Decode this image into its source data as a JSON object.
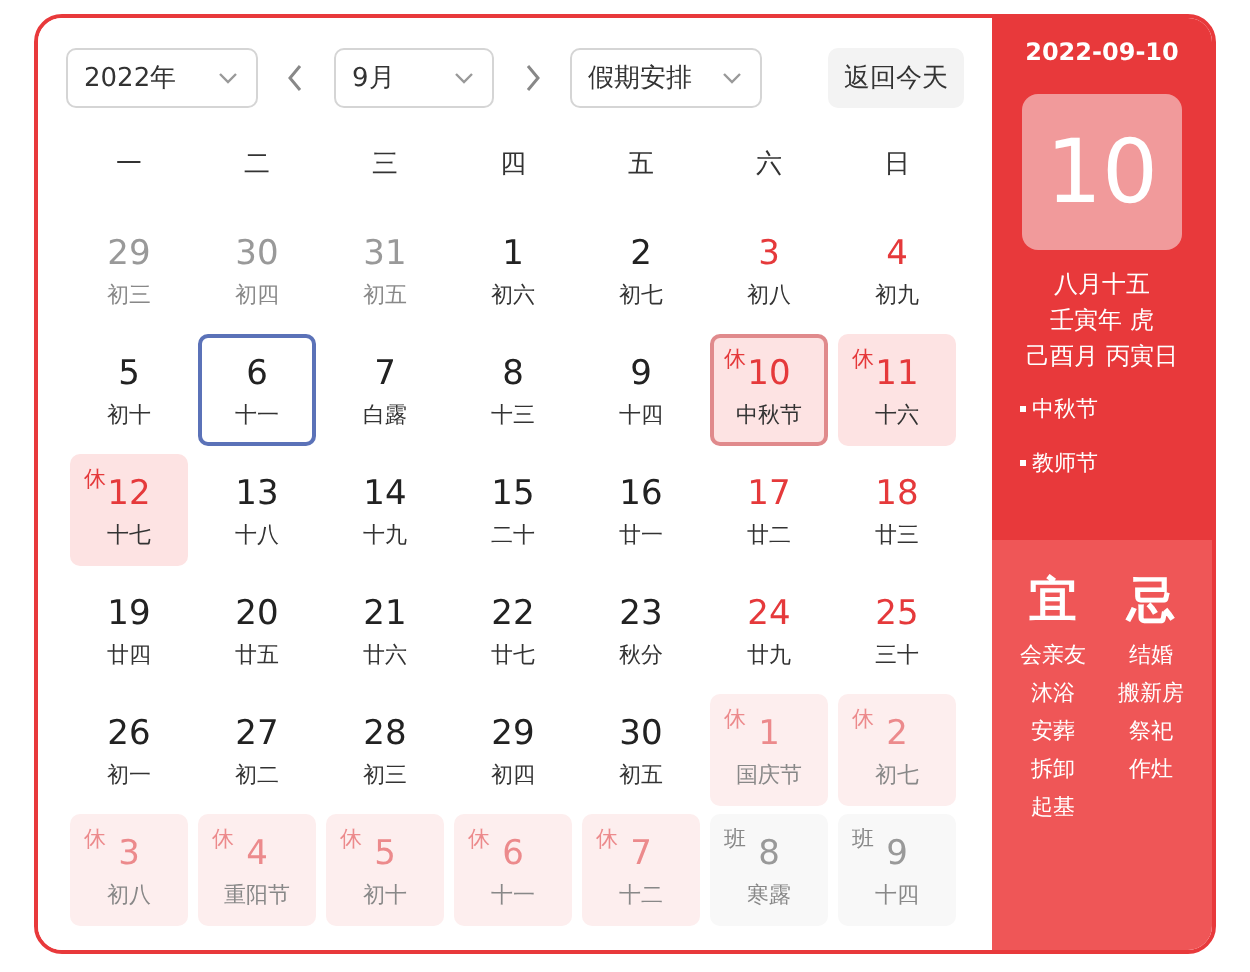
{
  "toolbar": {
    "year": "2022年",
    "month": "9月",
    "holiday": "假期安排",
    "today_button": "返回今天"
  },
  "weekdays": [
    "一",
    "二",
    "三",
    "四",
    "五",
    "六",
    "日"
  ],
  "days": [
    {
      "day": "29",
      "lunar": "初三",
      "muted": true,
      "red": false,
      "kind": "normal",
      "selected": false,
      "today": false
    },
    {
      "day": "30",
      "lunar": "初四",
      "muted": true,
      "red": false,
      "kind": "normal",
      "selected": false,
      "today": false
    },
    {
      "day": "31",
      "lunar": "初五",
      "muted": true,
      "red": false,
      "kind": "normal",
      "selected": false,
      "today": false
    },
    {
      "day": "1",
      "lunar": "初六",
      "muted": false,
      "red": false,
      "kind": "normal",
      "selected": false,
      "today": false
    },
    {
      "day": "2",
      "lunar": "初七",
      "muted": false,
      "red": false,
      "kind": "normal",
      "selected": false,
      "today": false
    },
    {
      "day": "3",
      "lunar": "初八",
      "muted": false,
      "red": true,
      "kind": "normal",
      "selected": false,
      "today": false
    },
    {
      "day": "4",
      "lunar": "初九",
      "muted": false,
      "red": true,
      "kind": "normal",
      "selected": false,
      "today": false
    },
    {
      "day": "5",
      "lunar": "初十",
      "muted": false,
      "red": false,
      "kind": "normal",
      "selected": false,
      "today": false
    },
    {
      "day": "6",
      "lunar": "十一",
      "muted": false,
      "red": false,
      "kind": "normal",
      "selected": false,
      "today": true
    },
    {
      "day": "7",
      "lunar": "白露",
      "muted": false,
      "red": false,
      "kind": "normal",
      "selected": false,
      "today": false
    },
    {
      "day": "8",
      "lunar": "十三",
      "muted": false,
      "red": false,
      "kind": "normal",
      "selected": false,
      "today": false
    },
    {
      "day": "9",
      "lunar": "十四",
      "muted": false,
      "red": false,
      "kind": "normal",
      "selected": false,
      "today": false
    },
    {
      "day": "10",
      "lunar": "中秋节",
      "badge": "休",
      "muted": false,
      "red": true,
      "kind": "rest",
      "selected": true,
      "today": false
    },
    {
      "day": "11",
      "lunar": "十六",
      "badge": "休",
      "muted": false,
      "red": true,
      "kind": "rest",
      "selected": false,
      "today": false
    },
    {
      "day": "12",
      "lunar": "十七",
      "badge": "休",
      "muted": false,
      "red": true,
      "kind": "rest",
      "selected": false,
      "today": false
    },
    {
      "day": "13",
      "lunar": "十八",
      "muted": false,
      "red": false,
      "kind": "normal",
      "selected": false,
      "today": false
    },
    {
      "day": "14",
      "lunar": "十九",
      "muted": false,
      "red": false,
      "kind": "normal",
      "selected": false,
      "today": false
    },
    {
      "day": "15",
      "lunar": "二十",
      "muted": false,
      "red": false,
      "kind": "normal",
      "selected": false,
      "today": false
    },
    {
      "day": "16",
      "lunar": "廿一",
      "muted": false,
      "red": false,
      "kind": "normal",
      "selected": false,
      "today": false
    },
    {
      "day": "17",
      "lunar": "廿二",
      "muted": false,
      "red": true,
      "kind": "normal",
      "selected": false,
      "today": false
    },
    {
      "day": "18",
      "lunar": "廿三",
      "muted": false,
      "red": true,
      "kind": "normal",
      "selected": false,
      "today": false
    },
    {
      "day": "19",
      "lunar": "廿四",
      "muted": false,
      "red": false,
      "kind": "normal",
      "selected": false,
      "today": false
    },
    {
      "day": "20",
      "lunar": "廿五",
      "muted": false,
      "red": false,
      "kind": "normal",
      "selected": false,
      "today": false
    },
    {
      "day": "21",
      "lunar": "廿六",
      "muted": false,
      "red": false,
      "kind": "normal",
      "selected": false,
      "today": false
    },
    {
      "day": "22",
      "lunar": "廿七",
      "muted": false,
      "red": false,
      "kind": "normal",
      "selected": false,
      "today": false
    },
    {
      "day": "23",
      "lunar": "秋分",
      "muted": false,
      "red": false,
      "kind": "normal",
      "selected": false,
      "today": false
    },
    {
      "day": "24",
      "lunar": "廿九",
      "muted": false,
      "red": true,
      "kind": "normal",
      "selected": false,
      "today": false
    },
    {
      "day": "25",
      "lunar": "三十",
      "muted": false,
      "red": true,
      "kind": "normal",
      "selected": false,
      "today": false
    },
    {
      "day": "26",
      "lunar": "初一",
      "muted": false,
      "red": false,
      "kind": "normal",
      "selected": false,
      "today": false
    },
    {
      "day": "27",
      "lunar": "初二",
      "muted": false,
      "red": false,
      "kind": "normal",
      "selected": false,
      "today": false
    },
    {
      "day": "28",
      "lunar": "初三",
      "muted": false,
      "red": false,
      "kind": "normal",
      "selected": false,
      "today": false
    },
    {
      "day": "29",
      "lunar": "初四",
      "muted": false,
      "red": false,
      "kind": "normal",
      "selected": false,
      "today": false
    },
    {
      "day": "30",
      "lunar": "初五",
      "muted": false,
      "red": false,
      "kind": "normal",
      "selected": false,
      "today": false
    },
    {
      "day": "1",
      "lunar": "国庆节",
      "badge": "休",
      "muted": true,
      "red": true,
      "kind": "rest",
      "selected": false,
      "today": false
    },
    {
      "day": "2",
      "lunar": "初七",
      "badge": "休",
      "muted": true,
      "red": true,
      "kind": "rest",
      "selected": false,
      "today": false
    },
    {
      "day": "3",
      "lunar": "初八",
      "badge": "休",
      "muted": true,
      "red": true,
      "kind": "rest",
      "selected": false,
      "today": false
    },
    {
      "day": "4",
      "lunar": "重阳节",
      "badge": "休",
      "muted": true,
      "red": true,
      "kind": "rest",
      "selected": false,
      "today": false
    },
    {
      "day": "5",
      "lunar": "初十",
      "badge": "休",
      "muted": true,
      "red": true,
      "kind": "rest",
      "selected": false,
      "today": false
    },
    {
      "day": "6",
      "lunar": "十一",
      "badge": "休",
      "muted": true,
      "red": true,
      "kind": "rest",
      "selected": false,
      "today": false
    },
    {
      "day": "7",
      "lunar": "十二",
      "badge": "休",
      "muted": true,
      "red": true,
      "kind": "rest",
      "selected": false,
      "today": false
    },
    {
      "day": "8",
      "lunar": "寒露",
      "badge": "班",
      "muted": true,
      "red": false,
      "kind": "work",
      "selected": false,
      "today": false
    },
    {
      "day": "9",
      "lunar": "十四",
      "badge": "班",
      "muted": true,
      "red": false,
      "kind": "work",
      "selected": false,
      "today": false
    }
  ],
  "detail": {
    "date": "2022-09-10",
    "day": "10",
    "lunar": [
      "八月十五",
      "壬寅年 虎",
      "己酉月 丙寅日"
    ],
    "festivals": [
      "中秋节",
      "教师节"
    ],
    "good": {
      "title": "宜",
      "items": [
        "会亲友",
        "沐浴",
        "安葬",
        "拆卸",
        "起基"
      ]
    },
    "bad": {
      "title": "忌",
      "items": [
        "结婚",
        "搬新房",
        "祭祀",
        "作灶"
      ]
    }
  }
}
